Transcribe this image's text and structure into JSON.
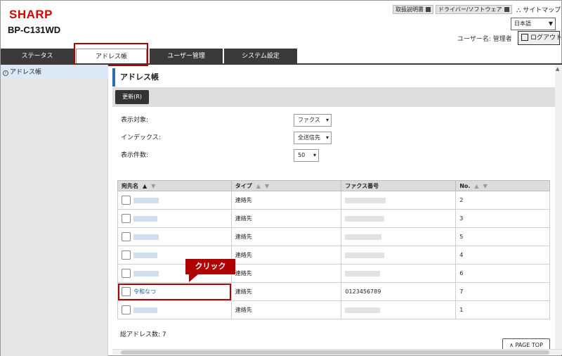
{
  "header": {
    "logo": "SHARP",
    "model": "BP-C131WD",
    "links": [
      "取扱説明書",
      "ドライバー/ソフトウェア"
    ],
    "sitemap": "サイトマップ",
    "language": "日本語",
    "username": "ユーザー名: 管理者",
    "logout": "ログアウト"
  },
  "tabs": [
    {
      "label": "ステータス"
    },
    {
      "label": "アドレス帳"
    },
    {
      "label": "ユーザー管理"
    },
    {
      "label": "システム設定"
    }
  ],
  "sidebar": {
    "items": [
      {
        "label": "アドレス帳"
      }
    ]
  },
  "main": {
    "title": "アドレス帳",
    "refresh": "更新(R)",
    "filters": {
      "target_label": "表示対象:",
      "target_value": "ファクス",
      "index_label": "インデックス:",
      "index_value": "全送信先",
      "count_label": "表示件数:",
      "count_value": "50"
    },
    "columns": [
      "宛先名",
      "タイプ",
      "ファクス番号",
      "No."
    ],
    "rows": [
      {
        "name": "",
        "type": "連絡先",
        "fax": "",
        "no": "2"
      },
      {
        "name": "",
        "type": "連絡先",
        "fax": "",
        "no": "3"
      },
      {
        "name": "",
        "type": "連絡先",
        "fax": "",
        "no": "5"
      },
      {
        "name": "",
        "type": "連絡先",
        "fax": "",
        "no": "4"
      },
      {
        "name": "",
        "type": "連絡先",
        "fax": "",
        "no": "6"
      },
      {
        "name": "令和なつ",
        "type": "連絡先",
        "fax": "0123456789",
        "no": "7"
      },
      {
        "name": "",
        "type": "連絡先",
        "fax": "",
        "no": "1"
      }
    ],
    "total": "総アドレス数:  7",
    "page_top": "PAGE TOP"
  },
  "annotation": {
    "callout": "クリック"
  },
  "colors": {
    "brand": "#d50000",
    "accent": "#b00000",
    "link": "#1f5faa"
  }
}
